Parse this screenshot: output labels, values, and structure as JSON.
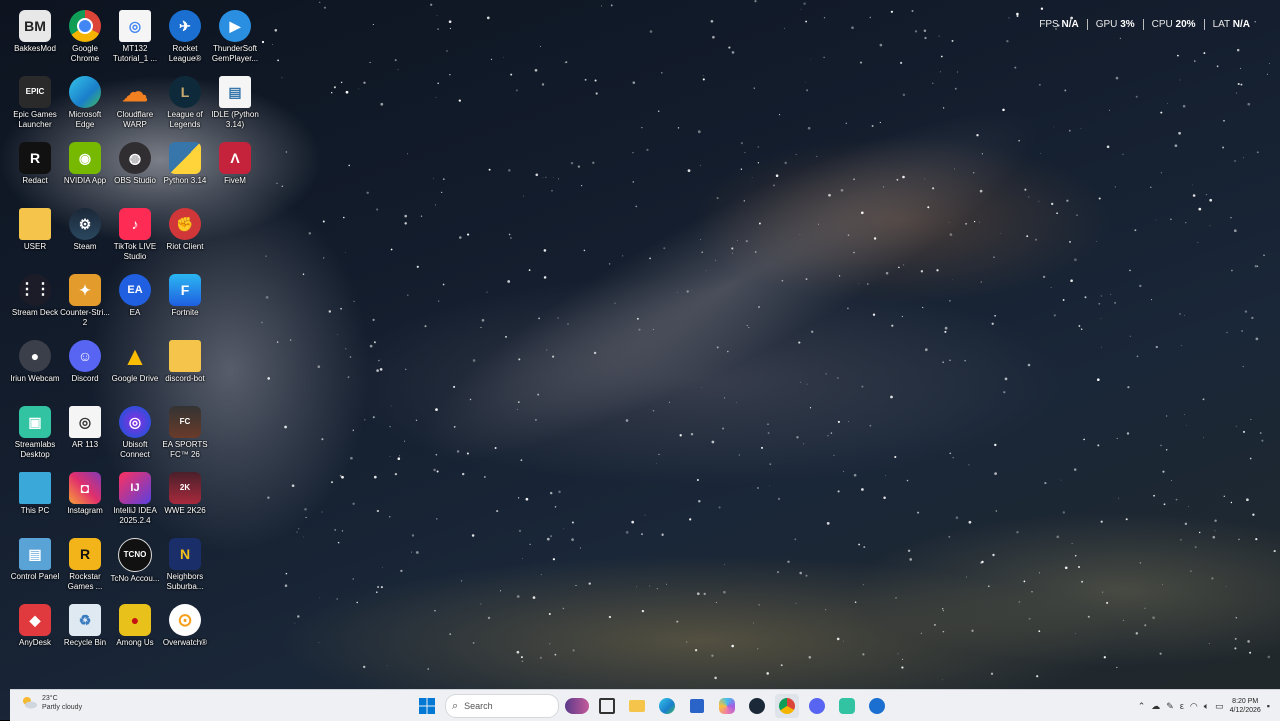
{
  "overlay": {
    "fps_label": "FPS",
    "fps_value": "N/A",
    "gpu_label": "GPU",
    "gpu_value": "3%",
    "cpu_label": "CPU",
    "cpu_value": "20%",
    "lat_label": "LAT",
    "lat_value": "N/A"
  },
  "desktop_icons": {
    "bakkesmod": "BakkesMod",
    "google_chrome": "Google Chrome",
    "mt132": "MT132 Tutorial_1 ...",
    "rocket_league": "Rocket League®",
    "thundersoft": "ThunderSoft GemPlayer...",
    "epic_games": "Epic Games Launcher",
    "microsoft_edge": "Microsoft Edge",
    "cloudflare_warp": "Cloudflare WARP",
    "league_of_legends": "League of Legends",
    "idle_python": "IDLE (Python 3.14)",
    "redact": "Redact",
    "nvidia_app": "NVIDIA App",
    "obs_studio": "OBS Studio",
    "python": "Python 3.14",
    "fivem": "FiveM",
    "user": "USER",
    "steam": "Steam",
    "tiktok_live": "TikTok LIVE Studio",
    "riot_client": "Riot Client",
    "stream_deck": "Stream Deck",
    "counter_strike": "Counter-Stri... 2",
    "ea": "EA",
    "fortnite": "Fortnite",
    "iriun_webcam": "Iriun Webcam",
    "discord": "Discord",
    "google_drive": "Google Drive",
    "discord_bot": "discord-bot",
    "streamlabs": "Streamlabs Desktop",
    "ar113": "AR 113",
    "ubisoft_connect": "Ubisoft Connect",
    "ea_sports_fc": "EA SPORTS FC™ 26",
    "this_pc": "This PC",
    "instagram": "Instagram",
    "intellij": "IntelliJ IDEA 2025.2.4",
    "wwe2k26": "WWE 2K26",
    "control_panel": "Control Panel",
    "rockstar": "Rockstar Games ...",
    "tcno": "TcNo Accou...",
    "neighbors": "Neighbors Suburba...",
    "anydesk": "AnyDesk",
    "recycle_bin": "Recycle Bin",
    "among_us": "Among Us",
    "overwatch": "Overwatch®"
  },
  "taskbar": {
    "weather_temp": "23°C",
    "weather_desc": "Partly cloudy",
    "search_placeholder": "Search",
    "clock_time": "8:20 PM",
    "clock_date": "4/12/2026"
  },
  "colors": {
    "taskbar_bg": "#eef0f3",
    "windows_blue": "#0078d4"
  }
}
